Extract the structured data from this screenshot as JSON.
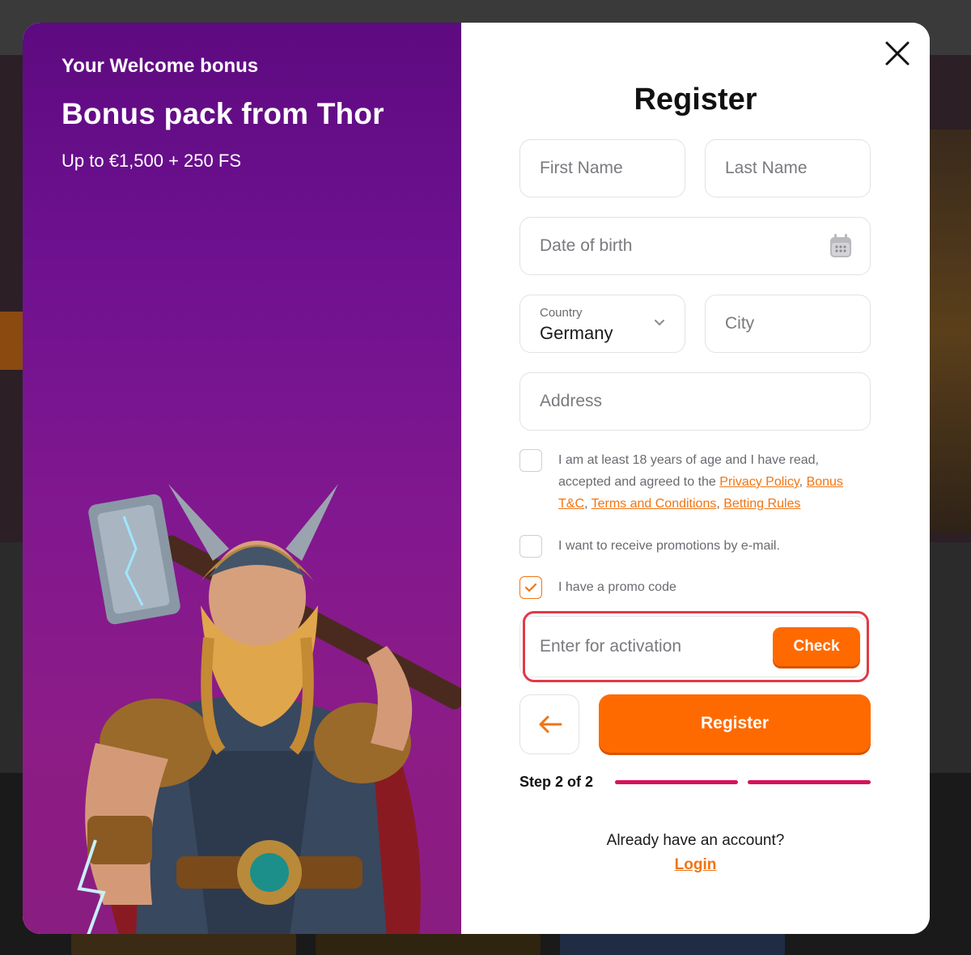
{
  "promo": {
    "eyebrow": "Your Welcome bonus",
    "title": "Bonus pack from Thor",
    "subtitle": "Up to €1,500 + 250 FS"
  },
  "form": {
    "title": "Register",
    "first_name_placeholder": "First Name",
    "last_name_placeholder": "Last Name",
    "dob_placeholder": "Date of birth",
    "country_label": "Country",
    "country_value": "Germany",
    "city_placeholder": "City",
    "address_placeholder": "Address",
    "consent": {
      "pre": "I am at least 18 years of age and I have read, accepted and agreed to the",
      "links": [
        "Privacy Policy",
        "Bonus T&C",
        "Terms and Conditions",
        "Betting Rules"
      ],
      "checked": false
    },
    "promotions": {
      "label": "I want to receive promotions by e-mail.",
      "checked": false
    },
    "promo_code": {
      "label": "I have a promo code",
      "checked": true
    },
    "promo_input_placeholder": "Enter for activation",
    "check_label": "Check",
    "register_label": "Register",
    "step_text": "Step 2 of 2",
    "step_current": 2,
    "step_total": 2,
    "login_prompt": "Already have an account?",
    "login_label": "Login"
  },
  "colors": {
    "accent_orange": "#ff6a00",
    "link_orange": "#f07512",
    "step_bar": "#d6135c",
    "promo_panel_top": "#5e0a80",
    "highlight_red": "#e03a46"
  },
  "icons": [
    "close-icon",
    "calendar-icon",
    "chevron-down-icon",
    "check-icon",
    "arrow-left-icon"
  ]
}
